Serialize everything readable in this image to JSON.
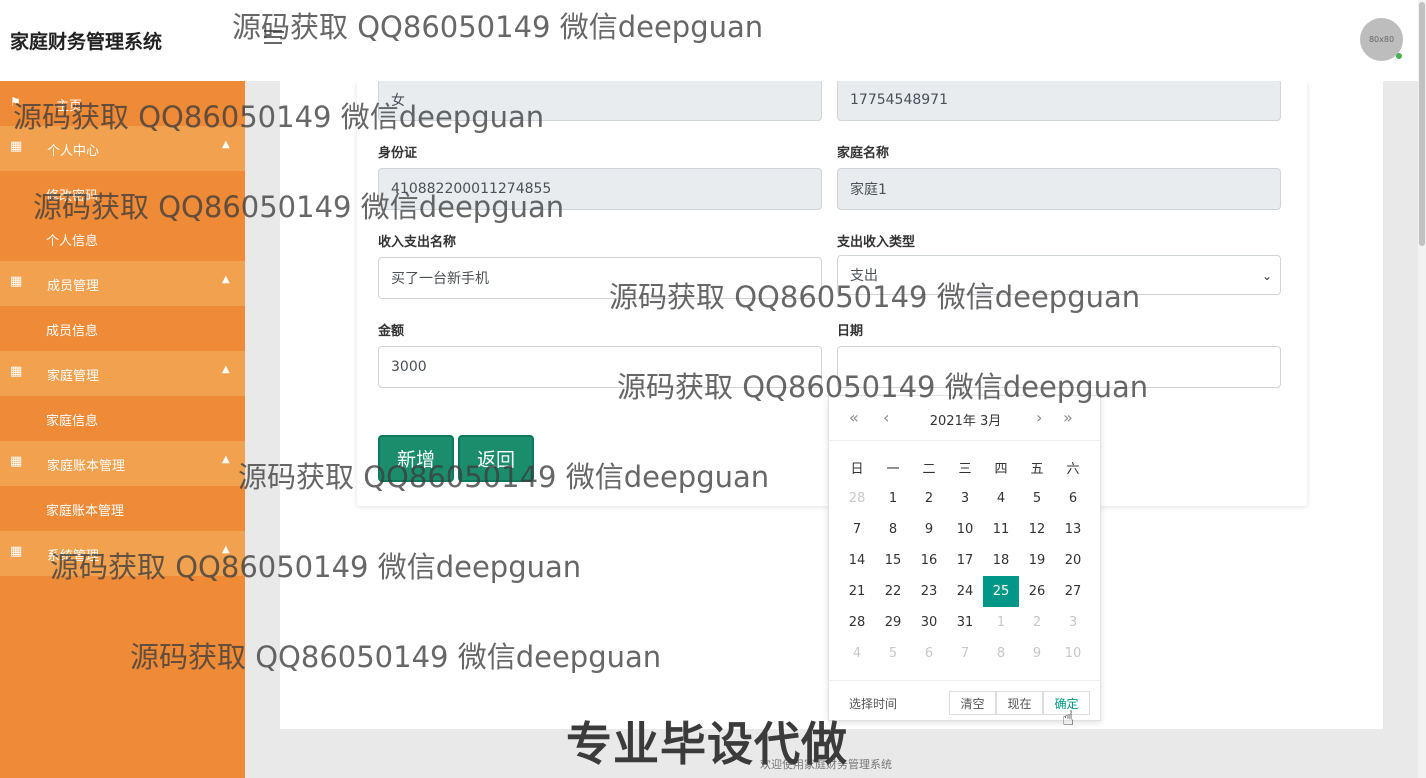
{
  "header": {
    "app_title": "家庭财务管理系统",
    "avatar_text": "80x80"
  },
  "sidebar": {
    "home": "主页",
    "groups": [
      {
        "label": "个人中心",
        "items": [
          "修改密码",
          "个人信息"
        ]
      },
      {
        "label": "成员管理",
        "items": [
          "成员信息"
        ]
      },
      {
        "label": "家庭管理",
        "items": [
          "家庭信息"
        ]
      },
      {
        "label": "家庭账本管理",
        "items": [
          "家庭账本管理"
        ]
      },
      {
        "label": "系统管理",
        "items": []
      }
    ]
  },
  "form": {
    "gender_value": "女",
    "phone_value": "17754548971",
    "id_label": "身份证",
    "id_value": "410882200011274855",
    "family_label": "家庭名称",
    "family_value": "家庭1",
    "name_label": "收入支出名称",
    "name_value": "买了一台新手机",
    "type_label": "支出收入类型",
    "type_value": "支出",
    "amount_label": "金额",
    "amount_value": "3000",
    "date_label": "日期",
    "date_value": "",
    "add_button": "新增",
    "back_button": "返回"
  },
  "datepicker": {
    "title": "2021年 3月",
    "weekdays": [
      "日",
      "一",
      "二",
      "三",
      "四",
      "五",
      "六"
    ],
    "weeks": [
      [
        "28",
        "1",
        "2",
        "3",
        "4",
        "5",
        "6"
      ],
      [
        "7",
        "8",
        "9",
        "10",
        "11",
        "12",
        "13"
      ],
      [
        "14",
        "15",
        "16",
        "17",
        "18",
        "19",
        "20"
      ],
      [
        "21",
        "22",
        "23",
        "24",
        "25",
        "26",
        "27"
      ],
      [
        "28",
        "29",
        "30",
        "31",
        "1",
        "2",
        "3"
      ],
      [
        "4",
        "5",
        "6",
        "7",
        "8",
        "9",
        "10"
      ]
    ],
    "selected_day": "25",
    "select_time": "选择时间",
    "clear": "清空",
    "now": "现在",
    "confirm": "确定"
  },
  "footer": {
    "text": "欢迎使用家庭财务管理系统"
  },
  "promo": "专业毕设代做",
  "watermark": "源码获取 QQ86050149 微信deepguan",
  "colors": {
    "sidebar": "#ef8a37",
    "sidebar_group": "#f2a14f",
    "accent": "#009688",
    "button": "#1b8d6c"
  }
}
